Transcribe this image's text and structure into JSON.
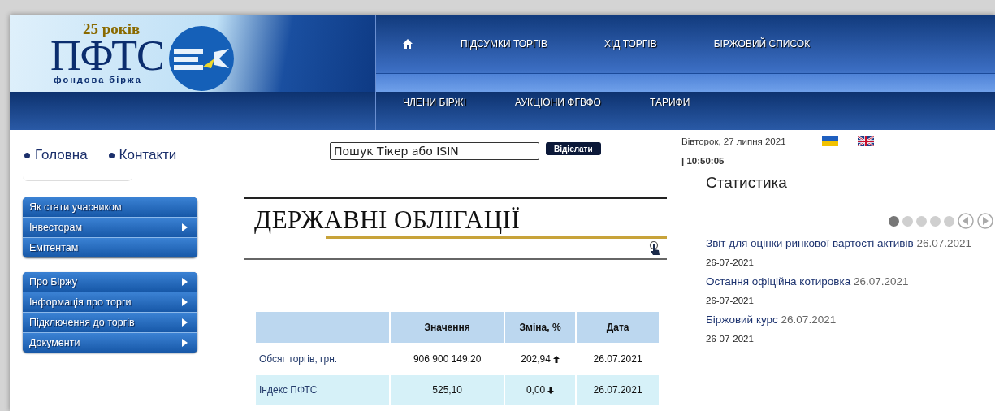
{
  "logo": {
    "anniversary": "25 років",
    "name": "ПФТС",
    "tagline": "фондова біржа"
  },
  "top_nav": [
    {
      "label": "ПІДСУМКИ ТОРГІВ"
    },
    {
      "label": "ХІД ТОРГІВ"
    },
    {
      "label": "БІРЖОВИЙ СПИСОК"
    }
  ],
  "sub_nav": [
    {
      "label": "ЧЛЕНИ БІРЖІ"
    },
    {
      "label": "АУКЦІОНИ ФГВФО"
    },
    {
      "label": "ТАРИФИ"
    }
  ],
  "quick_links": [
    {
      "label": "Головна"
    },
    {
      "label": "Контакти"
    }
  ],
  "search": {
    "value": "Пошук Тікер або ISIN",
    "button": "Відіслати"
  },
  "date": "Вівторок, 27 липня 2021",
  "time": "| 10:50:05",
  "sidebar_groups": [
    {
      "items": [
        {
          "label": "Як стати учасником",
          "submenu": false
        },
        {
          "label": "Інвесторам",
          "submenu": true
        },
        {
          "label": "Емітентам",
          "submenu": false
        }
      ]
    },
    {
      "items": [
        {
          "label": "Про Біржу",
          "submenu": true
        },
        {
          "label": "Інформація про торги",
          "submenu": true
        },
        {
          "label": "Підключення до торгів",
          "submenu": true
        },
        {
          "label": "Документи",
          "submenu": true
        }
      ]
    }
  ],
  "page_title": "ДЕРЖАВНІ ОБЛІГАЦІЇ",
  "table": {
    "columns": [
      "Значення",
      "Зміна, %",
      "Дата"
    ],
    "rows": [
      {
        "label": "Обсяг торгів, грн.",
        "value": "906 900 149,20",
        "change": "202,94",
        "kind": "up",
        "date": "26.07.2021",
        "shaded": false
      },
      {
        "label": "Індекс ПФТС",
        "value": "525,10",
        "change": "0,00",
        "kind": "down",
        "date": "26.07.2021",
        "shaded": true
      }
    ]
  },
  "statistics": {
    "title": "Статистика",
    "pages": [
      {
        "selected": true
      },
      {
        "selected": false
      },
      {
        "selected": false
      },
      {
        "selected": false
      },
      {
        "selected": false
      }
    ],
    "items": [
      {
        "title": "Звіт для оцінки ринкової вартості активів",
        "date_suffix": "26.07.2021",
        "date": "26-07-2021"
      },
      {
        "title": "Остання офіційна котировка",
        "date_suffix": "26.07.2021",
        "date": "26-07-2021"
      },
      {
        "title": "Біржовий курс",
        "date_suffix": "26.07.2021",
        "date": "26-07-2021"
      }
    ]
  }
}
